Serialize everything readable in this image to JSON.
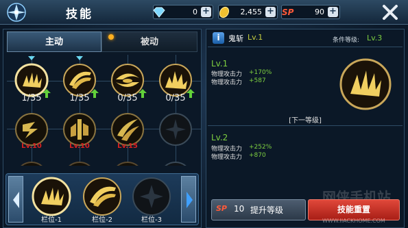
{
  "header": {
    "title": "技能",
    "diamonds": "0",
    "gold": "2,455",
    "sp_label": "SP",
    "sp": "90",
    "plus": "+"
  },
  "tabs": {
    "active": "主动",
    "passive": "被动"
  },
  "skills": [
    {
      "icon": "flame-claw-icon",
      "level": "1/35",
      "upgradable": true
    },
    {
      "icon": "blade-fan-icon",
      "level": "1/35",
      "upgradable": true
    },
    {
      "icon": "whirlwind-icon",
      "level": "0/35",
      "upgradable": true
    },
    {
      "icon": "flame-burst-icon",
      "level": "0/35",
      "upgradable": true
    },
    {
      "icon": "slash-icon",
      "requirement": "Lv.10"
    },
    {
      "icon": "blade-pillar-icon",
      "requirement": "Lv.10"
    },
    {
      "icon": "wave-slash-icon",
      "requirement": "Lv.15"
    },
    {
      "icon": "locked-vortex-icon"
    }
  ],
  "slots": [
    {
      "label": "栏位-1",
      "icon": "flame-claw-icon"
    },
    {
      "label": "栏位-2",
      "icon": "blade-fan-icon"
    },
    {
      "label": "栏位-3",
      "icon": "empty-vortex-icon"
    }
  ],
  "detail": {
    "name": "鬼斩",
    "level": "Lv.1",
    "req_label": "条件等级:",
    "req_level": "Lv.3",
    "current": {
      "head": "Lv.1",
      "stats": [
        {
          "label": "物理攻击力",
          "value": "+170%"
        },
        {
          "label": "物理攻击力",
          "value": "+587"
        }
      ]
    },
    "next_title": "[下一等级]",
    "next": {
      "head": "Lv.2",
      "stats": [
        {
          "label": "物理攻击力",
          "value": "+252%"
        },
        {
          "label": "物理攻击力",
          "value": "+870"
        }
      ]
    }
  },
  "buttons": {
    "upgrade_sp": "SP",
    "upgrade_cost": "10",
    "upgrade_label": "提升等级",
    "reset_label": "技能重置"
  },
  "watermark": {
    "text": "WWW.IIACKHOME.COM",
    "big": "网侠手机站"
  },
  "colors": {
    "accent_green": "#7ed040",
    "requirement_red": "#d82020",
    "reset_red": "#c0302a"
  }
}
